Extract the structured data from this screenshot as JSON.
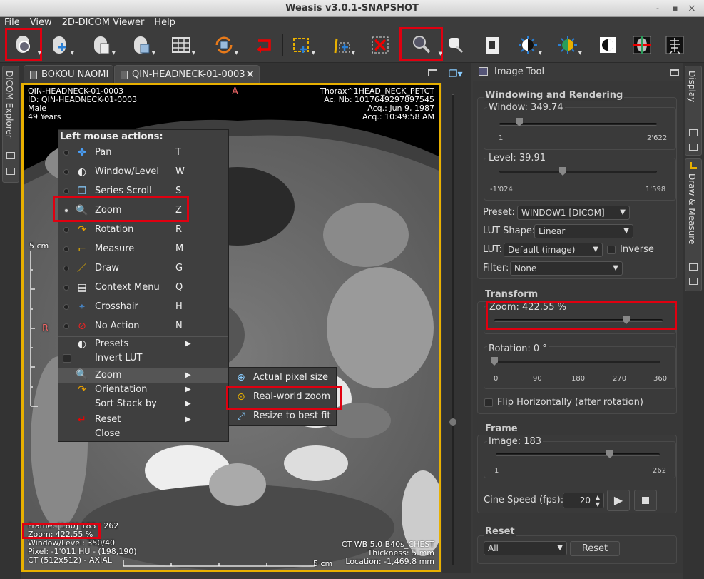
{
  "app": {
    "title": "Weasis v3.0.1-SNAPSHOT",
    "window_controls": [
      "-",
      "▪",
      "×"
    ]
  },
  "menubar": [
    "File",
    "View",
    "2D-DICOM Viewer",
    "Help"
  ],
  "tabs": [
    {
      "label": "BOKOU NAOMI"
    },
    {
      "label": "QIN-HEADNECK-01-0003"
    }
  ],
  "left_vtab": "DICOM Explorer",
  "right_vtabs": [
    "Display",
    "Draw & Measure"
  ],
  "overlay": {
    "tl": [
      "QIN-HEADNECK-01-0003",
      "ID: QIN-HEADNECK-01-0003",
      "Male",
      "49 Years"
    ],
    "tr": [
      "Thorax^1HEAD_NECK_PETCT",
      "Ac. Nb: 1017649297897545",
      "Acq.: Jun 9, 1987",
      "Acq.: 10:49:58 AM"
    ],
    "orient_top": "A",
    "orient_left": "R",
    "scale": "5 cm",
    "scale_bottom": "5 cm",
    "bl": [
      "Frame: [180] 183 / 262",
      "Zoom: 422.55 %",
      "Window/Level: 350/40",
      "Pixel: -1'011 HU - (198,190)",
      "CT (512x512) - AXIAL"
    ],
    "br": [
      "CT WB 5.0 B40s_CHEST",
      "Thickness: 5 mm",
      "Location: -1,469.8 mm"
    ]
  },
  "context_menu": {
    "header": "Left mouse actions:",
    "actions": [
      {
        "label": "Pan",
        "shortcut": "T",
        "icon": "pan-icon"
      },
      {
        "label": "Window/Level",
        "shortcut": "W",
        "icon": "window-level-icon"
      },
      {
        "label": "Series Scroll",
        "shortcut": "S",
        "icon": "series-scroll-icon"
      },
      {
        "label": "Zoom",
        "shortcut": "Z",
        "icon": "zoom-icon"
      },
      {
        "label": "Rotation",
        "shortcut": "R",
        "icon": "rotation-icon"
      },
      {
        "label": "Measure",
        "shortcut": "M",
        "icon": "measure-icon"
      },
      {
        "label": "Draw",
        "shortcut": "G",
        "icon": "draw-icon"
      },
      {
        "label": "Context Menu",
        "shortcut": "Q",
        "icon": "context-menu-icon"
      },
      {
        "label": "Crosshair",
        "shortcut": "H",
        "icon": "crosshair-icon"
      },
      {
        "label": "No Action",
        "shortcut": "N",
        "icon": "no-action-icon"
      }
    ],
    "presets": "Presets",
    "invert_lut": "Invert LUT",
    "zoom": "Zoom",
    "orientation": "Orientation",
    "sort_stack": "Sort Stack by",
    "reset": "Reset",
    "close": "Close"
  },
  "submenu": [
    "Actual pixel size",
    "Real-world zoom",
    "Resize to best fit"
  ],
  "panel": {
    "title": "Image Tool",
    "windowing": {
      "title": "Windowing and Rendering",
      "window_label": "Window: 349.74",
      "window_min": "1",
      "window_max": "2'622",
      "level_label": "Level: 39.91",
      "level_min": "-1'024",
      "level_max": "1'598",
      "preset_label": "Preset:",
      "preset_value": "WINDOW1 [DICOM]",
      "lut_shape_label": "LUT Shape:",
      "lut_shape_value": "Linear",
      "lut_label": "LUT:",
      "lut_value": "Default (image)",
      "inverse_label": "Inverse",
      "filter_label": "Filter:",
      "filter_value": "None"
    },
    "transform": {
      "title": "Transform",
      "zoom_label": "Zoom: 422.55 %",
      "rotation_label": "Rotation: 0 °",
      "rotation_ticks": [
        "0",
        "90",
        "180",
        "270",
        "360"
      ],
      "flip_label": "Flip Horizontally (after rotation)"
    },
    "frame": {
      "title": "Frame",
      "image_label": "Image: 183",
      "image_min": "1",
      "image_max": "262",
      "cine_label": "Cine Speed (fps):",
      "cine_value": "20"
    },
    "reset": {
      "title": "Reset",
      "select_value": "All",
      "button": "Reset"
    }
  }
}
